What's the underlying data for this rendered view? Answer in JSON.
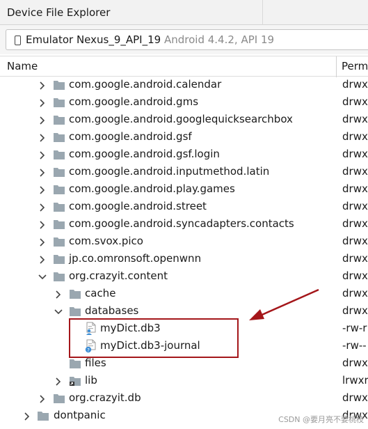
{
  "window": {
    "title": "Device File Explorer"
  },
  "device": {
    "name": "Emulator Nexus_9_API_19",
    "info": "Android 4.4.2, API 19"
  },
  "columns": {
    "name": "Name",
    "permissions": "Perm"
  },
  "rows": [
    {
      "label": "com.google.android.calendar",
      "perm": "drwx",
      "type": "folder",
      "depth": 2,
      "arrow": "right"
    },
    {
      "label": "com.google.android.gms",
      "perm": "drwx",
      "type": "folder",
      "depth": 2,
      "arrow": "right"
    },
    {
      "label": "com.google.android.googlequicksearchbox",
      "perm": "drwx",
      "type": "folder",
      "depth": 2,
      "arrow": "right"
    },
    {
      "label": "com.google.android.gsf",
      "perm": "drwx",
      "type": "folder",
      "depth": 2,
      "arrow": "right"
    },
    {
      "label": "com.google.android.gsf.login",
      "perm": "drwx",
      "type": "folder",
      "depth": 2,
      "arrow": "right"
    },
    {
      "label": "com.google.android.inputmethod.latin",
      "perm": "drwx",
      "type": "folder",
      "depth": 2,
      "arrow": "right"
    },
    {
      "label": "com.google.android.play.games",
      "perm": "drwx",
      "type": "folder",
      "depth": 2,
      "arrow": "right"
    },
    {
      "label": "com.google.android.street",
      "perm": "drwx",
      "type": "folder",
      "depth": 2,
      "arrow": "right"
    },
    {
      "label": "com.google.android.syncadapters.contacts",
      "perm": "drwx",
      "type": "folder",
      "depth": 2,
      "arrow": "right"
    },
    {
      "label": "com.svox.pico",
      "perm": "drwx",
      "type": "folder",
      "depth": 2,
      "arrow": "right"
    },
    {
      "label": "jp.co.omronsoft.openwnn",
      "perm": "drwx",
      "type": "folder",
      "depth": 2,
      "arrow": "right"
    },
    {
      "label": "org.crazyit.content",
      "perm": "drwx",
      "type": "folder",
      "depth": 2,
      "arrow": "down"
    },
    {
      "label": "cache",
      "perm": "drwx",
      "type": "folder",
      "depth": 3,
      "arrow": "right"
    },
    {
      "label": "databases",
      "perm": "drwx",
      "type": "folder",
      "depth": 3,
      "arrow": "down"
    },
    {
      "label": "myDict.db3",
      "perm": "-rw-r",
      "type": "db-file",
      "depth": 4,
      "arrow": "none"
    },
    {
      "label": "myDict.db3-journal",
      "perm": "-rw--",
      "type": "db-journal-file",
      "depth": 4,
      "arrow": "none"
    },
    {
      "label": "files",
      "perm": "drwx",
      "type": "folder",
      "depth": 3,
      "arrow": "none"
    },
    {
      "label": "lib",
      "perm": "lrwxr",
      "type": "link-folder",
      "depth": 3,
      "arrow": "right"
    },
    {
      "label": "org.crazyit.db",
      "perm": "drwx",
      "type": "folder",
      "depth": 2,
      "arrow": "right"
    },
    {
      "label": "dontpanic",
      "perm": "drwx",
      "type": "folder",
      "depth": 1,
      "arrow": "right"
    }
  ],
  "watermark": "CSDN @要月亮不要桃枝",
  "colors": {
    "folder": "#9aa7b0",
    "annotation": "#a4161a",
    "db_person": "#3f8fd6"
  }
}
